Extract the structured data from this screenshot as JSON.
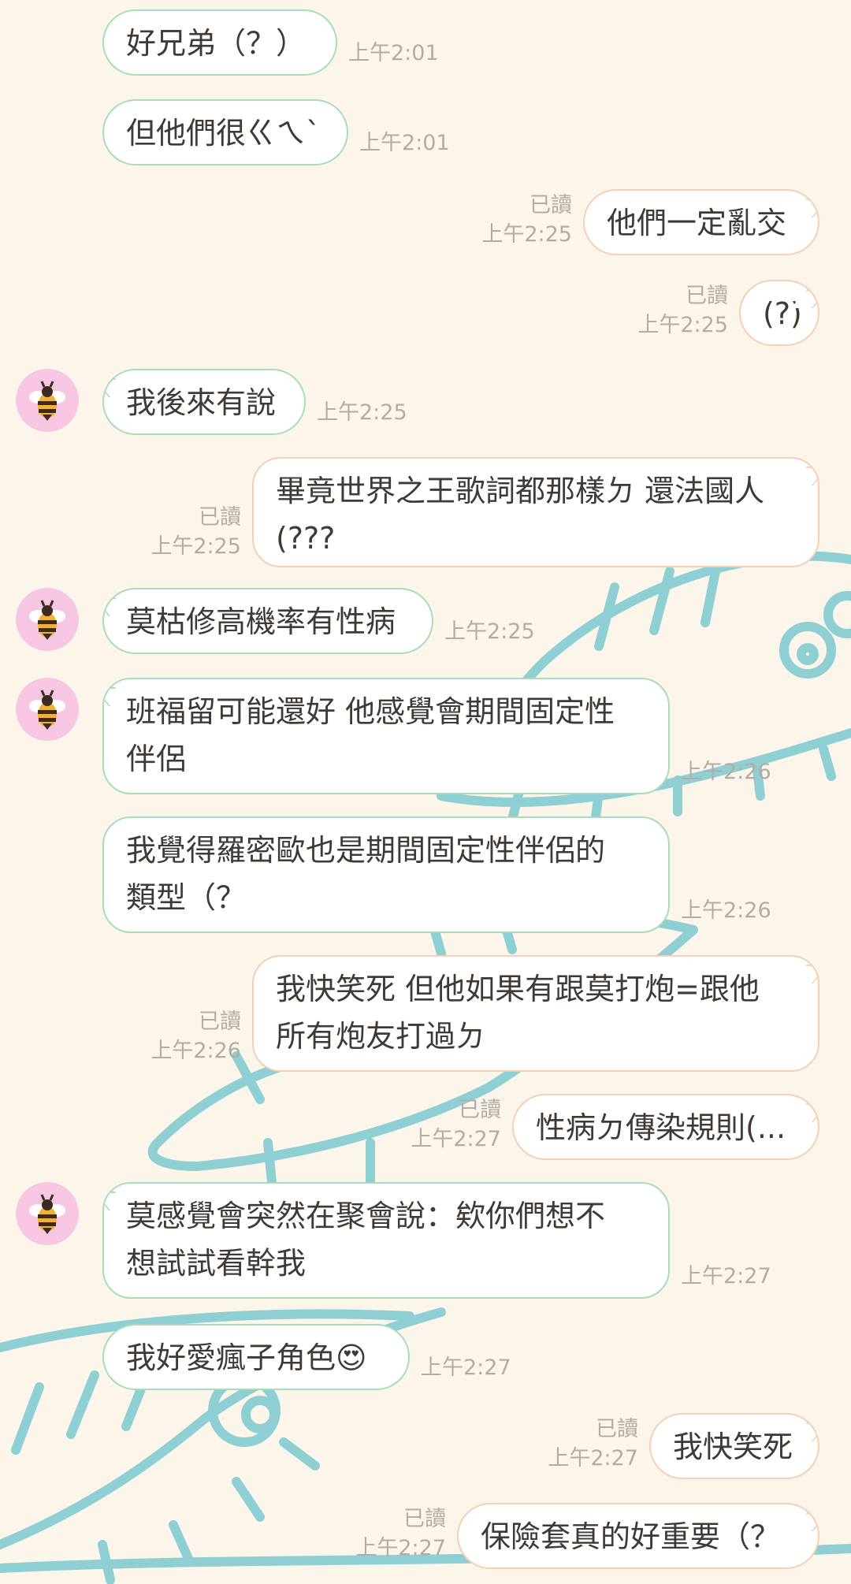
{
  "theme": {
    "background": "#fcf6ea",
    "incoming_border": "#a9ddb6",
    "outgoing_border": "#f6cfb5",
    "doodle": "#8ecfd4",
    "avatar_bg": "#f7c6e3"
  },
  "contact": {
    "avatar_icon": "bee-icon"
  },
  "messages": [
    {
      "dir": "in",
      "avatar": false,
      "text": "好兄弟（？）",
      "time": "上午2:01"
    },
    {
      "dir": "in",
      "avatar": false,
      "text": "但他們很ㄍㄟˋ",
      "time": "上午2:01"
    },
    {
      "dir": "out",
      "read": "已讀",
      "text": "他們一定亂交",
      "time": "上午2:25"
    },
    {
      "dir": "out",
      "read": "已讀",
      "text": "(?)",
      "time": "上午2:25"
    },
    {
      "dir": "in",
      "avatar": true,
      "text": "我後來有說",
      "time": "上午2:25"
    },
    {
      "dir": "out",
      "read": "已讀",
      "text": "畢竟世界之王歌詞都那樣ㄉ 還法國人\n(???",
      "time": "上午2:25"
    },
    {
      "dir": "in",
      "avatar": true,
      "text": "莫枯修高機率有性病",
      "time": "上午2:25"
    },
    {
      "dir": "in",
      "avatar": true,
      "text": "班福留可能還好 他感覺會期間固定性\n伴侶",
      "time": "上午2:26"
    },
    {
      "dir": "in",
      "avatar": false,
      "text": "我覺得羅密歐也是期間固定性伴侶的\n類型（？",
      "time": "上午2:26"
    },
    {
      "dir": "out",
      "read": "已讀",
      "text": "我快笑死 但他如果有跟莫打炮=跟他\n所有炮友打過ㄉ",
      "time": "上午2:26"
    },
    {
      "dir": "out",
      "read": "已讀",
      "text": "性病ㄉ傳染規則(...",
      "time": "上午2:27"
    },
    {
      "dir": "in",
      "avatar": true,
      "text": "莫感覺會突然在聚會說：欸你們想不\n想試試看幹我",
      "time": "上午2:27"
    },
    {
      "dir": "in",
      "avatar": false,
      "text": "我好愛瘋子角色😍",
      "time": "上午2:27"
    },
    {
      "dir": "out",
      "read": "已讀",
      "text": "我快笑死",
      "time": "上午2:27"
    },
    {
      "dir": "out",
      "read": "已讀",
      "text": "保險套真的好重要（？",
      "time": "上午2:27"
    }
  ]
}
